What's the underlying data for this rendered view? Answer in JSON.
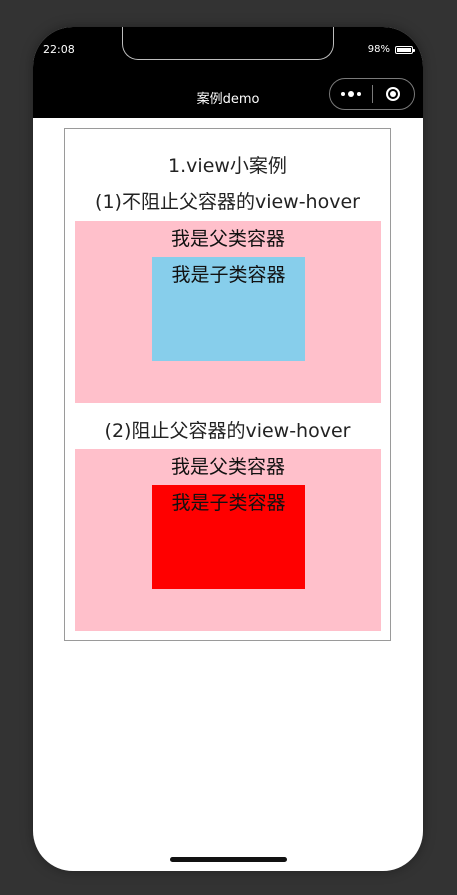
{
  "status_bar": {
    "time": "22:08",
    "battery_percent": "98%",
    "battery_level": 0.98
  },
  "nav": {
    "title": "案例demo",
    "more_icon": "more-dots-icon",
    "close_icon": "target-close-icon"
  },
  "main": {
    "heading": "1.view小案例",
    "section1": {
      "subtitle": "(1)不阻止父容器的view-hover",
      "parent_label": "我是父类容器",
      "child_label": "我是子类容器",
      "parent_color": "#ffc0cb",
      "child_color": "#87ceeb"
    },
    "section2": {
      "subtitle": "(2)阻止父容器的view-hover",
      "parent_label": "我是父类容器",
      "child_label": "我是子类容器",
      "parent_color": "#ffc0cb",
      "child_color": "#ff0000"
    }
  }
}
